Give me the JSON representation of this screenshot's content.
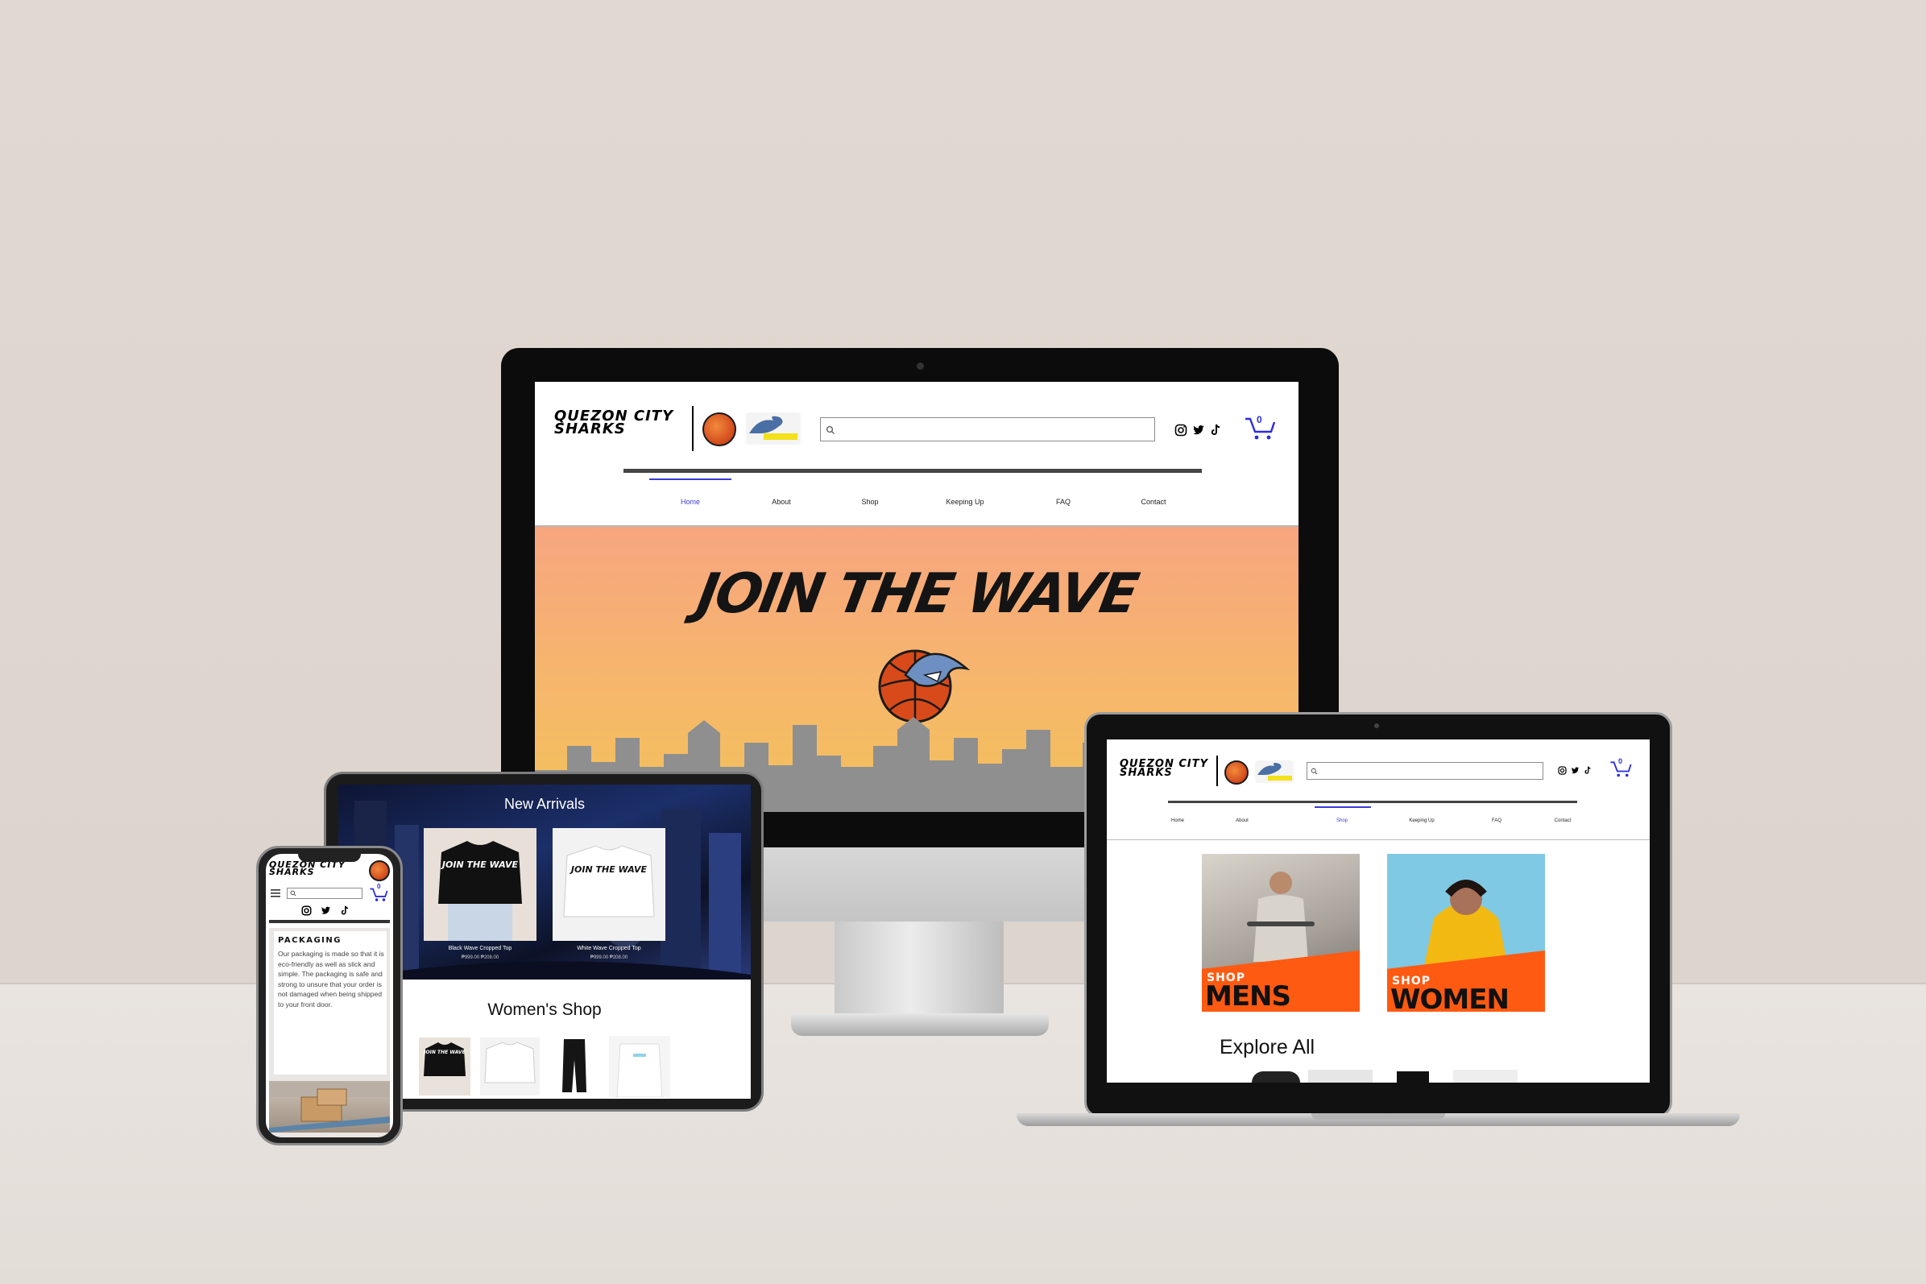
{
  "brand": {
    "name_line1": "QUEZON CITY",
    "name_line2": "SHARKS",
    "badge_text": "QUEZON CITY",
    "accent": "#3b3bd8",
    "hero_gradient_top": "#f7a57f",
    "hero_gradient_bottom": "#f3c15a",
    "shop_ribbon": "#ff5a12"
  },
  "desktop": {
    "nav": [
      {
        "label": "Home",
        "active": true
      },
      {
        "label": "About",
        "active": false
      },
      {
        "label": "Shop",
        "active": false
      },
      {
        "label": "Keeping Up",
        "active": false
      },
      {
        "label": "FAQ",
        "active": false
      },
      {
        "label": "Contact",
        "active": false
      }
    ],
    "social_icons": [
      "instagram-icon",
      "twitter-icon",
      "tiktok-icon"
    ],
    "cart_count": "0",
    "hero_title": "JOIN THE WAVE"
  },
  "laptop": {
    "nav": [
      {
        "label": "Home",
        "active": false
      },
      {
        "label": "About",
        "active": false
      },
      {
        "label": "Shop",
        "active": true
      },
      {
        "label": "Keeping Up",
        "active": false
      },
      {
        "label": "FAQ",
        "active": false
      },
      {
        "label": "Contact",
        "active": false
      }
    ],
    "cart_count": "0",
    "cards": [
      {
        "small": "SHOP",
        "big": "MENS"
      },
      {
        "small": "SHOP",
        "big": "WOMEN"
      }
    ],
    "explore_heading": "Explore All"
  },
  "tablet": {
    "new_arrivals_heading": "New Arrivals",
    "products": [
      {
        "name": "Black Wave Cropped Top",
        "tee_text": "JOIN THE WAVE",
        "price": "₱999.00 ₱208.00"
      },
      {
        "name": "White Wave Cropped Top",
        "tee_text": "JOIN THE WAVE",
        "price": "₱999.00 ₱208.00"
      }
    ],
    "womens_heading": "Women's Shop",
    "mini_tee_text": "JOIN THE WAVE"
  },
  "phone": {
    "cart_count": "0",
    "packaging_heading": "PACKAGING",
    "packaging_text": "Our packaging is made so that it is eco-friendly as well as slick and simple. The packaging is safe and strong to unsure that your order is not damaged when being shipped to your front door."
  }
}
